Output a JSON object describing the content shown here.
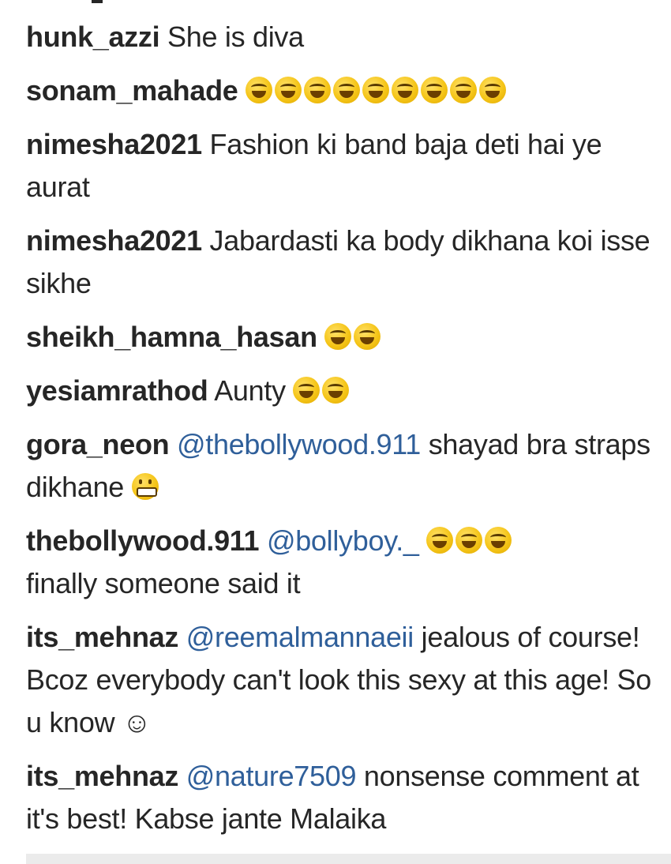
{
  "comments": [
    {
      "user": "hunk_azzi",
      "mention": "",
      "text": "She is diva",
      "emojis": [],
      "suffix": ""
    },
    {
      "user": "sonam_mahade",
      "mention": "",
      "text": "",
      "emojis": [
        "laugh",
        "laugh",
        "laugh",
        "laugh",
        "laugh",
        "laugh",
        "laugh",
        "laugh",
        "laugh"
      ],
      "suffix": ""
    },
    {
      "user": "nimesha2021",
      "mention": "",
      "text": "Fashion ki band baja deti hai ye aurat",
      "emojis": [],
      "suffix": ""
    },
    {
      "user": "nimesha2021",
      "mention": "",
      "text": "Jabardasti ka body dikhana koi isse sikhe",
      "emojis": [],
      "suffix": ""
    },
    {
      "user": "sheikh_hamna_hasan",
      "mention": "",
      "text": "",
      "emojis": [
        "laugh",
        "laugh"
      ],
      "suffix": ""
    },
    {
      "user": "yesiamrathod",
      "mention": "",
      "text": "Aunty",
      "emojis": [
        "laugh",
        "laugh"
      ],
      "suffix": ""
    },
    {
      "user": "gora_neon",
      "mention": "@thebollywood.911",
      "text": "shayad bra straps dikhane",
      "emojis": [
        "grin"
      ],
      "suffix": ""
    },
    {
      "user": "thebollywood.911",
      "mention": "@bollyboy._",
      "text": "",
      "emojis": [
        "laugh",
        "laugh",
        "laugh"
      ],
      "suffix": "finally someone said it"
    },
    {
      "user": "its_mehnaz",
      "mention": "@reemalmannaeii",
      "text": "jealous of course! Bcoz everybody can't look this sexy at this age! So u know ☺",
      "emojis": [],
      "suffix": ""
    },
    {
      "user": "its_mehnaz",
      "mention": "@nature7509",
      "text": "nonsense comment at it's best! Kabse jante Malaika",
      "emojis": [],
      "suffix": ""
    }
  ],
  "colors": {
    "username": "#262626",
    "mention": "#2f5f9a",
    "emoji": "#f5c518"
  },
  "icons": {
    "laugh": "face-with-tears-of-joy-icon",
    "grin": "grimacing-face-icon"
  }
}
